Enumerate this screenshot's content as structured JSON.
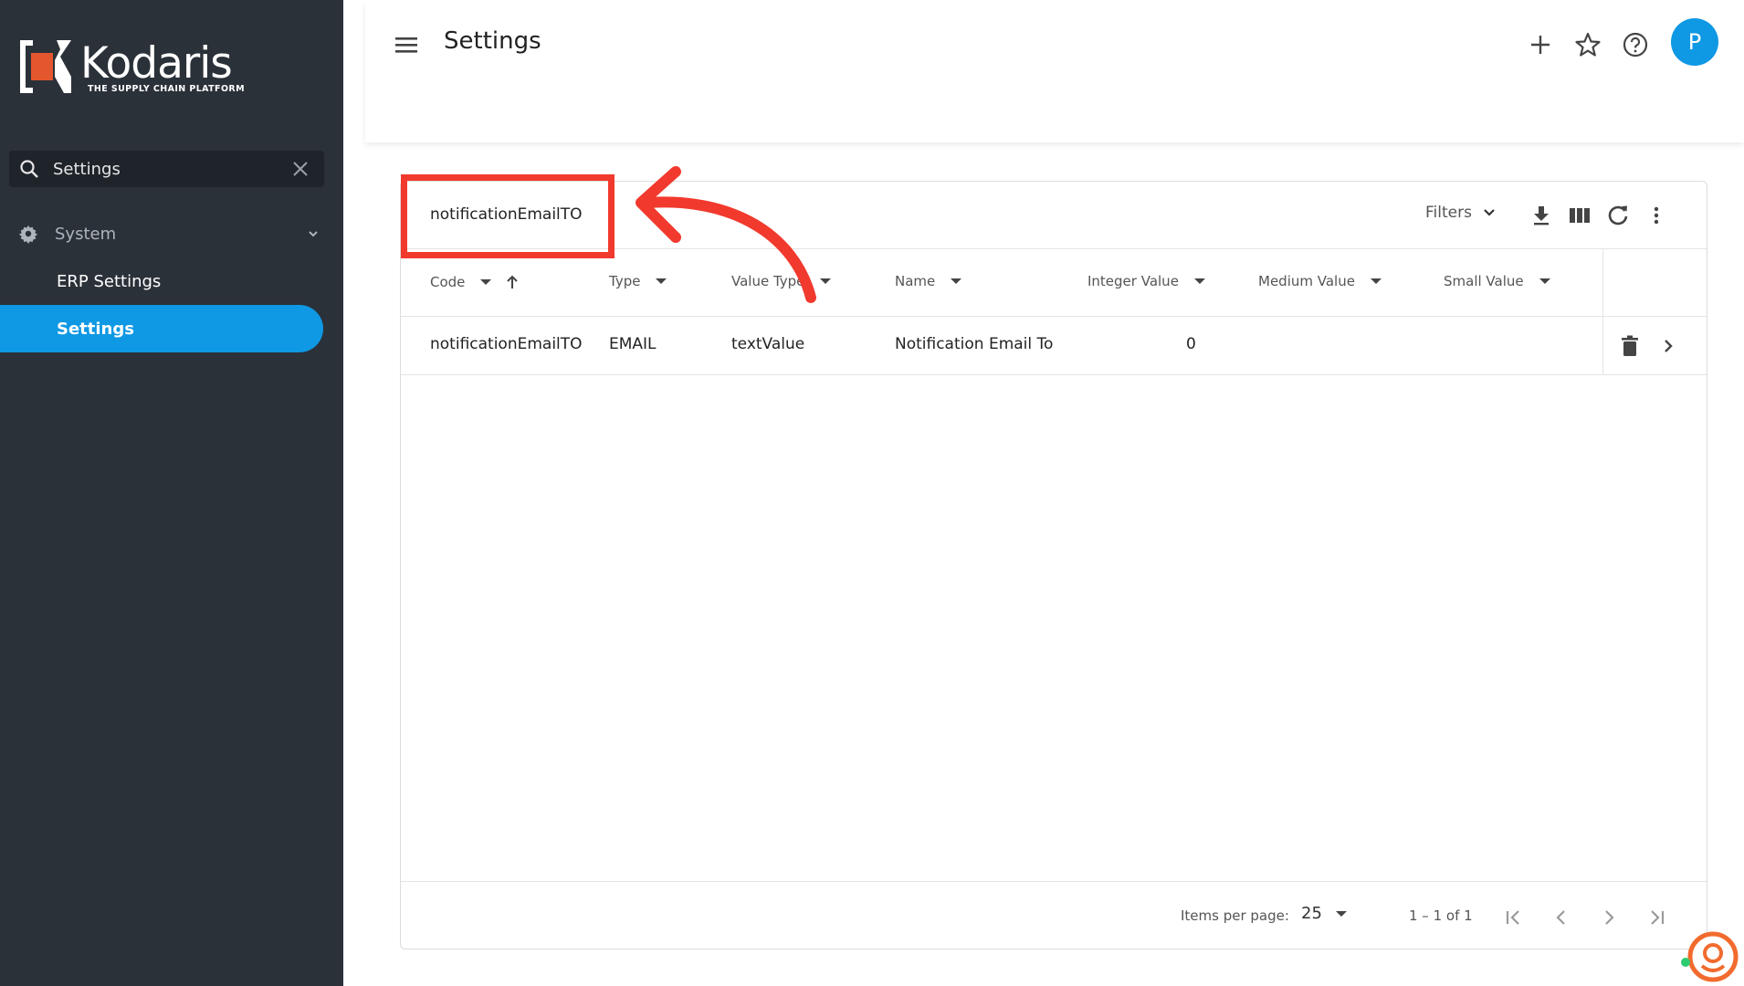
{
  "brand": {
    "name": "Kodaris",
    "tagline": "THE SUPPLY CHAIN PLATFORM",
    "accent": "#0f98e3",
    "logo_orange": "#e4572e"
  },
  "sidebar": {
    "search_value": "Settings",
    "group": {
      "label": "System",
      "icon": "gear-icon",
      "expanded": true
    },
    "items": [
      {
        "label": "ERP Settings",
        "active": false
      },
      {
        "label": "Settings",
        "active": true
      }
    ]
  },
  "header": {
    "title": "Settings",
    "icons": [
      "menu-icon",
      "plus-icon",
      "star-icon",
      "help-icon"
    ],
    "avatar_initial": "P"
  },
  "table": {
    "search_value": "notificationEmailTO",
    "filters_label": "Filters",
    "toolbar_icons": [
      "download-icon",
      "columns-icon",
      "refresh-icon",
      "more-vert-icon"
    ],
    "columns": [
      "Code",
      "Type",
      "Value Type",
      "Name",
      "Integer Value",
      "Medium Value",
      "Small Value"
    ],
    "rows": [
      {
        "code": "notificationEmailTO",
        "type": "EMAIL",
        "value_type": "textValue",
        "name": "Notification Email To",
        "integer_value": "0",
        "medium_value": "",
        "small_value": ""
      }
    ],
    "footer": {
      "items_per_page_label": "Items per page:",
      "items_per_page": "25",
      "range": "1 – 1 of 1"
    }
  },
  "annotation": {
    "color": "#f2392e"
  }
}
